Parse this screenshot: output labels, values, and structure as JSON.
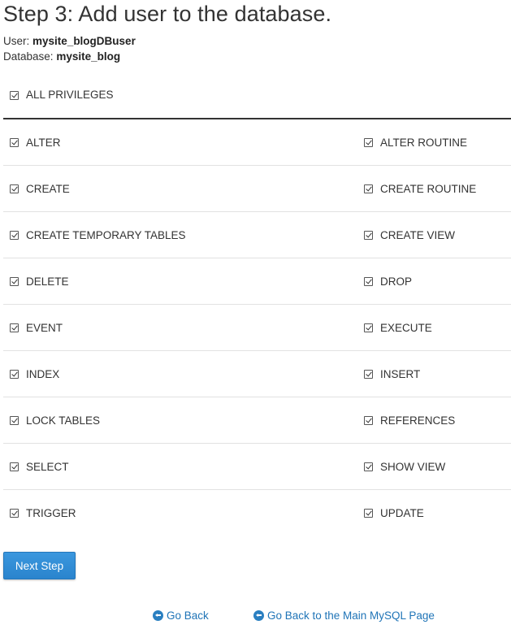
{
  "header": {
    "title": "Step 3: Add user to the database.",
    "user_label": "User:",
    "user_value": "mysite_blogDBuser",
    "database_label": "Database:",
    "database_value": "mysite_blog"
  },
  "all_privileges": {
    "label": "ALL PRIVILEGES",
    "checked": true
  },
  "privileges": [
    {
      "left": {
        "label": "ALTER",
        "checked": true
      },
      "right": {
        "label": "ALTER ROUTINE",
        "checked": true
      }
    },
    {
      "left": {
        "label": "CREATE",
        "checked": true
      },
      "right": {
        "label": "CREATE ROUTINE",
        "checked": true
      }
    },
    {
      "left": {
        "label": "CREATE TEMPORARY TABLES",
        "checked": true
      },
      "right": {
        "label": "CREATE VIEW",
        "checked": true
      }
    },
    {
      "left": {
        "label": "DELETE",
        "checked": true
      },
      "right": {
        "label": "DROP",
        "checked": true
      }
    },
    {
      "left": {
        "label": "EVENT",
        "checked": true
      },
      "right": {
        "label": "EXECUTE",
        "checked": true
      }
    },
    {
      "left": {
        "label": "INDEX",
        "checked": true
      },
      "right": {
        "label": "INSERT",
        "checked": true
      }
    },
    {
      "left": {
        "label": "LOCK TABLES",
        "checked": true
      },
      "right": {
        "label": "REFERENCES",
        "checked": true
      }
    },
    {
      "left": {
        "label": "SELECT",
        "checked": true
      },
      "right": {
        "label": "SHOW VIEW",
        "checked": true
      }
    },
    {
      "left": {
        "label": "TRIGGER",
        "checked": true
      },
      "right": {
        "label": "UPDATE",
        "checked": true
      }
    }
  ],
  "actions": {
    "next_step_label": "Next Step",
    "go_back_label": "Go Back",
    "go_back_main_label": "Go Back to the Main MySQL Page"
  },
  "icons": {
    "checkbox": "checkbox-checked-icon",
    "back": "circle-arrow-left-icon"
  },
  "colors": {
    "primary_button": "#2a8bd6",
    "link": "#1f74b7",
    "text": "#333333",
    "divider": "#e2e2e2"
  }
}
